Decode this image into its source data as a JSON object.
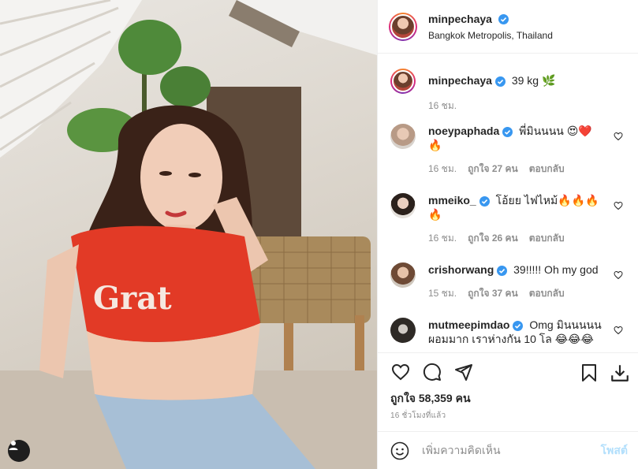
{
  "post": {
    "author": "minpechaya",
    "location": "Bangkok Metropolis, Thailand",
    "caption": "39 kg 🌿",
    "caption_time": "16 ชม.",
    "likes": "ถูกใจ 58,359 คน",
    "timestamp": "16 ชั่วโมงที่แล้ว",
    "photo_text": "Grat"
  },
  "comments": [
    {
      "user": "noeypaphada",
      "text": "พี่มินนนน 😍❤️🔥",
      "time": "16 ชม.",
      "likes": "ถูกใจ 27 คน",
      "reply": "ตอบกลับ"
    },
    {
      "user": "mmeiko_",
      "text": "โอ้ยย ไฟไหม้🔥🔥🔥🔥",
      "time": "16 ชม.",
      "likes": "ถูกใจ 26 คน",
      "reply": "ตอบกลับ"
    },
    {
      "user": "crishorwang",
      "text": "39!!!!! Oh my god",
      "time": "15 ชม.",
      "likes": "ถูกใจ 37 คน",
      "reply": "ตอบกลับ"
    },
    {
      "user": "mutmeepimdao",
      "text": "Omg มินนนนน ผอมมาก เราห่างกัน 10 โล 😂😂😂",
      "time": "",
      "likes": "",
      "reply": ""
    }
  ],
  "add_comment": {
    "placeholder": "เพิ่มความคิดเห็น",
    "post_label": "โพสต์"
  },
  "icons": [
    "heart-icon",
    "comment-icon",
    "share-icon",
    "bookmark-icon",
    "download-icon",
    "emoji-icon",
    "user-tag-icon",
    "verified-icon"
  ],
  "colors": {
    "verified": "#3897f0",
    "post_disabled": "#b2dffc",
    "muted": "#8e8e8e",
    "text": "#262626"
  }
}
